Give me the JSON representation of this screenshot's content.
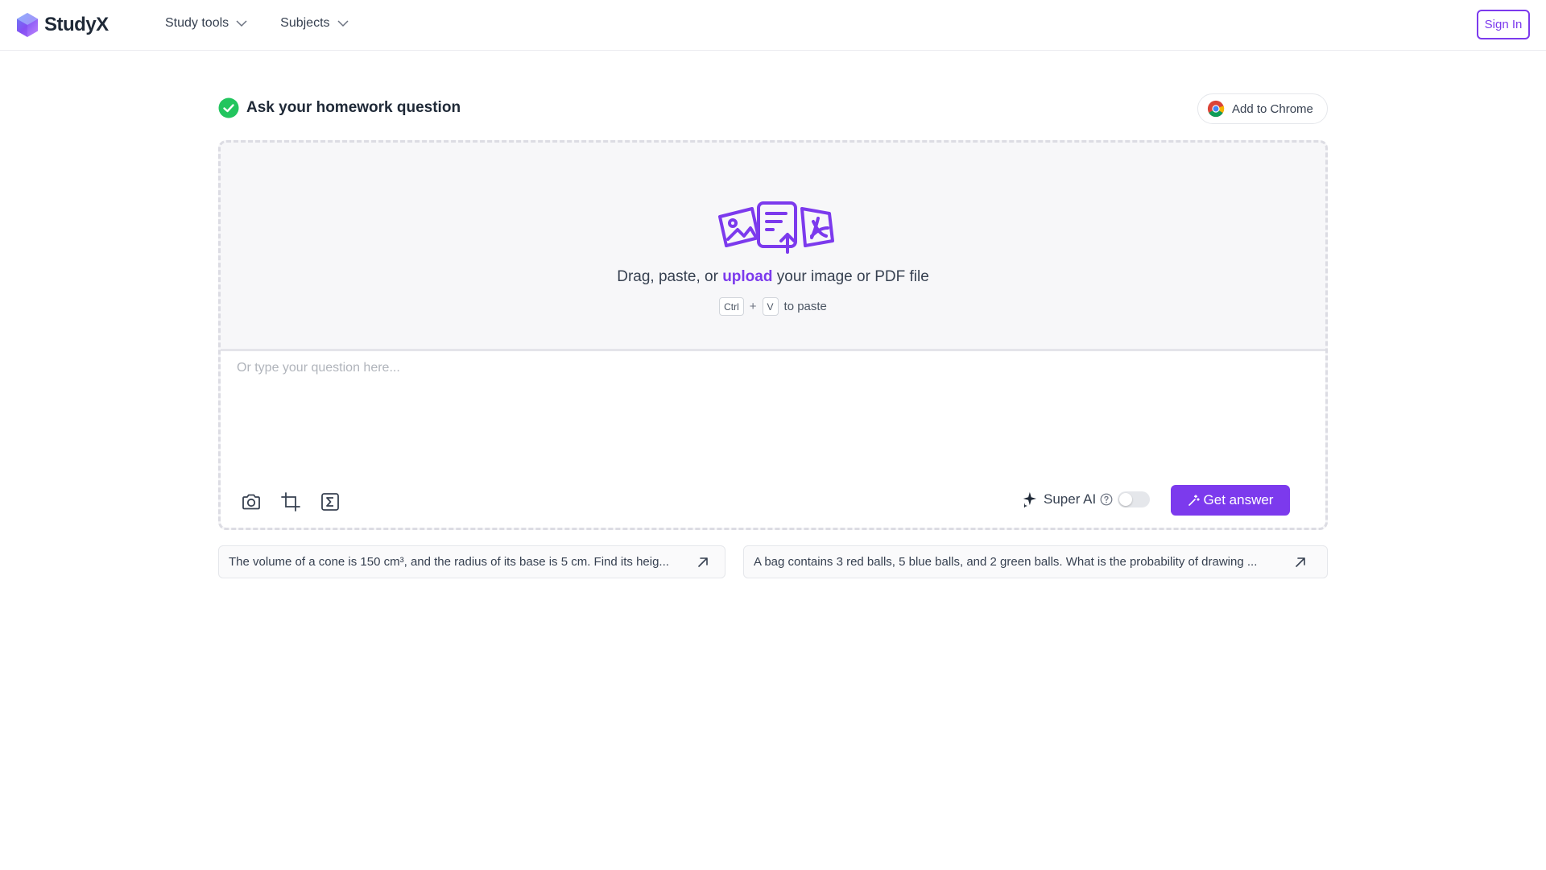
{
  "header": {
    "brand": "StudyX",
    "nav": [
      {
        "label": "Study tools"
      },
      {
        "label": "Subjects"
      }
    ],
    "signin_label": "Sign In"
  },
  "main": {
    "title": "Ask your homework question",
    "chrome_label": "Add to Chrome",
    "drop": {
      "text_before": "Drag, paste, or ",
      "upload_link": "upload",
      "text_after": " your image or PDF file",
      "key_ctrl": "Ctrl",
      "plus": "+",
      "key_v": "V",
      "paste_suffix": "to paste"
    },
    "input": {
      "placeholder": "Or type your question here...",
      "value": ""
    },
    "tools": [
      "camera-icon",
      "crop-icon",
      "formula-icon"
    ],
    "super_ai": {
      "label": "Super AI",
      "enabled": false
    },
    "get_answer_label": "Get answer"
  },
  "suggestions": [
    "The volume of a cone is 150 cm³, and the radius of its base is 5 cm. Find its heig...",
    "A bag contains 3 red balls, 5 blue balls, and 2 green balls. What is the probability of drawing ..."
  ],
  "colors": {
    "accent": "#7c3aed",
    "success": "#22c55e"
  }
}
